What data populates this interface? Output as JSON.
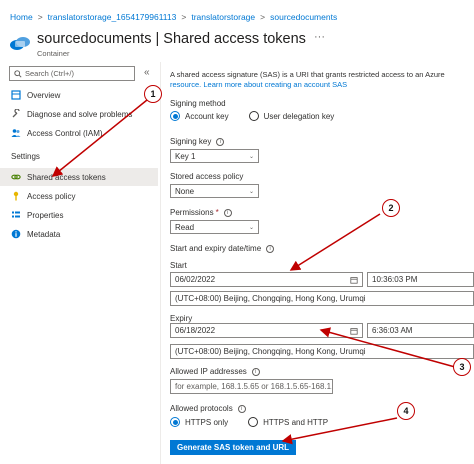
{
  "breadcrumb": [
    "Home",
    "translatorstorage_1654179961113",
    "translatorstorage",
    "sourcedocuments"
  ],
  "breadcrumb_sep": ">",
  "header": {
    "title": "sourcedocuments | Shared access tokens",
    "subtitle": "Container",
    "more": "···"
  },
  "sidebar": {
    "search_placeholder": "Search (Ctrl+/)",
    "collapse": "«",
    "items_top": [
      {
        "label": "Overview",
        "icon": "overview-icon"
      },
      {
        "label": "Diagnose and solve problems",
        "icon": "wrench-icon"
      },
      {
        "label": "Access Control (IAM)",
        "icon": "people-icon"
      }
    ],
    "section": "Settings",
    "items_settings": [
      {
        "label": "Shared access tokens",
        "icon": "link-icon",
        "active": true
      },
      {
        "label": "Access policy",
        "icon": "key-icon"
      },
      {
        "label": "Properties",
        "icon": "properties-icon"
      },
      {
        "label": "Metadata",
        "icon": "info-icon"
      }
    ]
  },
  "main": {
    "intro_text": "A shared access signature (SAS) is a URI that grants restricted access to an Azure",
    "intro_link": "resource. Learn more about creating an account SAS",
    "signing_method": {
      "label": "Signing method",
      "options": [
        "Account key",
        "User delegation key"
      ],
      "selected": 0
    },
    "signing_key": {
      "label": "Signing key",
      "value": "Key 1"
    },
    "stored_policy": {
      "label": "Stored access policy",
      "value": "None"
    },
    "permissions": {
      "label": "Permissions",
      "required": "*",
      "value": "Read"
    },
    "start_expiry": {
      "label": "Start and expiry date/time"
    },
    "start": {
      "label": "Start",
      "date": "06/02/2022",
      "time": "10:36:03 PM",
      "timezone": "(UTC+08:00) Beijing, Chongqing, Hong Kong, Urumqi"
    },
    "expiry": {
      "label": "Expiry",
      "date": "06/18/2022",
      "time": "6:36:03 AM",
      "timezone": "(UTC+08:00) Beijing, Chongqing, Hong Kong, Urumqi"
    },
    "allowed_ip": {
      "label": "Allowed IP addresses",
      "placeholder": "for example, 168.1.5.65 or 168.1.5.65-168.1...."
    },
    "allowed_protocols": {
      "label": "Allowed protocols",
      "options": [
        "HTTPS only",
        "HTTPS and HTTP"
      ],
      "selected": 0
    },
    "generate_button": "Generate SAS token and URL",
    "info_glyph": "i",
    "chevron": "⌄"
  },
  "callouts": [
    "1",
    "2",
    "3",
    "4"
  ],
  "colors": {
    "accent": "#0078d4",
    "annotation": "#c00000",
    "active_bg": "#edebe9"
  }
}
